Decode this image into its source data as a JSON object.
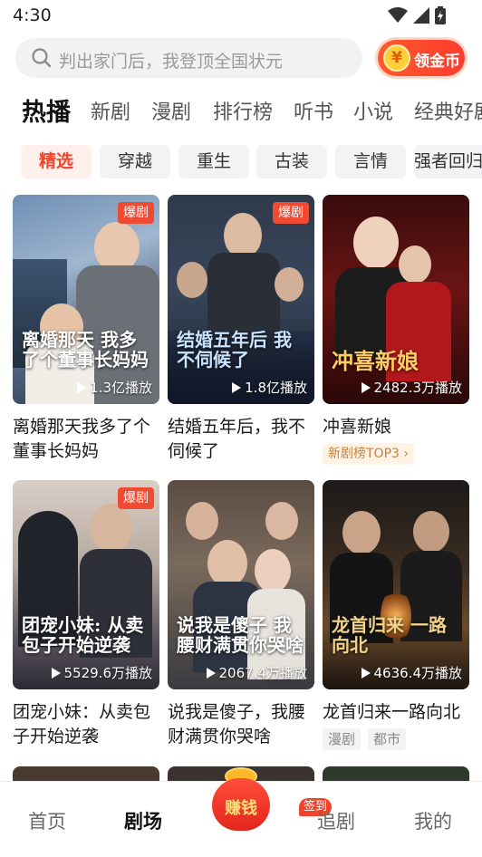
{
  "status": {
    "time": "4:30"
  },
  "search": {
    "placeholder": "判出家门后，我登顶全国状元"
  },
  "coin_button": {
    "symbol": "¥",
    "label": "领金币"
  },
  "main_tabs": [
    "热播",
    "新剧",
    "漫剧",
    "排行榜",
    "听书",
    "小说",
    "经典好剧"
  ],
  "chips": [
    "精选",
    "穿越",
    "重生",
    "古装",
    "言情",
    "强者回归"
  ],
  "cards": [
    {
      "title": "离婚那天我多了个董事长妈妈",
      "poster_text": "离婚那天 我多了个董事长妈妈",
      "plays": "1.3亿播放",
      "badge": "爆剧"
    },
    {
      "title": "结婚五年后，我不伺候了",
      "poster_text": "结婚五年后 我不伺候了",
      "plays": "1.8亿播放",
      "badge": "爆剧"
    },
    {
      "title": "冲喜新娘",
      "poster_text": "冲喜新娘",
      "plays": "2482.3万播放",
      "rank": "新剧榜TOP3 ›"
    },
    {
      "title": "团宠小妹：从卖包子开始逆袭",
      "poster_text": "团宠小妹: 从卖包子开始逆袭",
      "plays": "5529.6万播放",
      "badge": "爆剧"
    },
    {
      "title": "说我是傻子，我腰财满贯你哭啥",
      "poster_text": "说我是傻子 我腰财满贯你哭啥",
      "plays": "2067.4万播放"
    },
    {
      "title": "龙首归来一路向北",
      "poster_text": "龙首归来 一路向北",
      "plays": "4636.4万播放",
      "genres": [
        "漫剧",
        "都市"
      ]
    }
  ],
  "bottom_nav": {
    "home": "首页",
    "theater": "剧场",
    "earn": "赚钱",
    "follow": "追剧",
    "mine": "我的",
    "sign_in": "签到"
  },
  "colors": {
    "accent": "#f0442b",
    "coin_gradient": "#ff5a2a"
  }
}
